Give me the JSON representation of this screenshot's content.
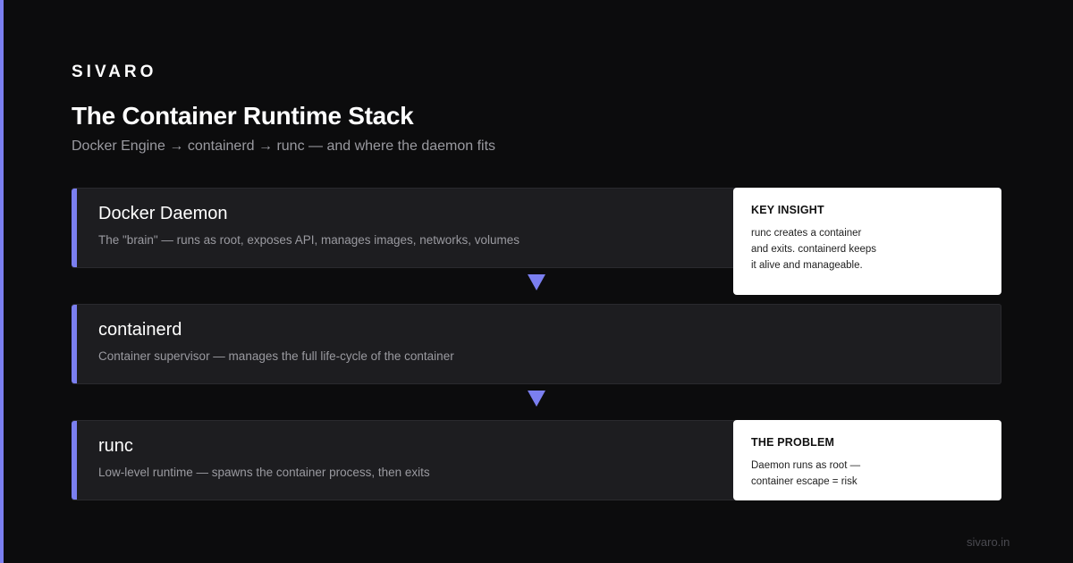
{
  "brand": "SIVARO",
  "title": "The Container Runtime Stack",
  "subtitle": "Docker Engine → containerd → runc — and where the daemon fits",
  "layers": [
    {
      "name": "Docker Daemon",
      "desc": "The \"brain\" — runs as root, exposes API, manages images, networks, volumes"
    },
    {
      "name": "containerd",
      "desc": "Container supervisor — manages the full life-cycle of the container"
    },
    {
      "name": "runc",
      "desc": "Low-level runtime — spawns the container process, then exits"
    }
  ],
  "cards": {
    "insight": {
      "title": "KEY INSIGHT",
      "body": "runc creates a container\nand exits. containerd keeps\nit alive and manageable."
    },
    "problem": {
      "title": "THE PROBLEM",
      "body": "Daemon runs as root —\ncontainer escape = risk"
    }
  },
  "footer": "sivaro.in",
  "colors": {
    "accent": "#7b7ff0",
    "background": "#0c0c0d",
    "layer": "#1d1d20",
    "card": "#ffffff"
  }
}
